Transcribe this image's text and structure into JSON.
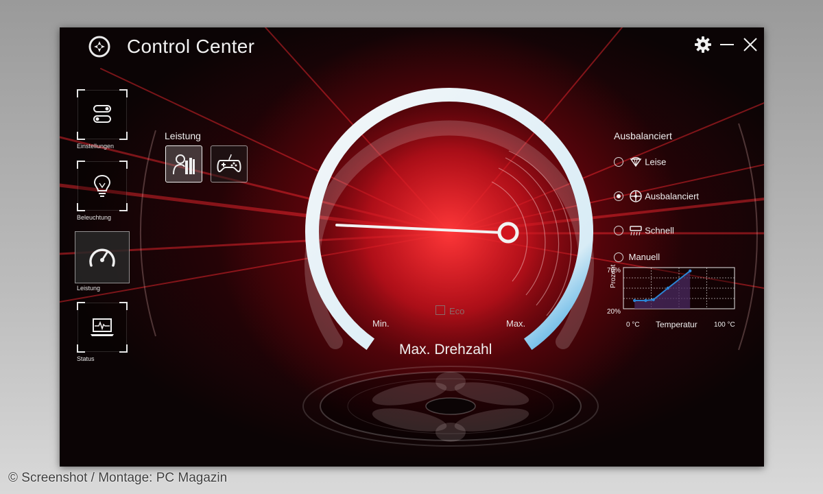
{
  "app": {
    "title": "Control Center"
  },
  "sidebar": {
    "items": [
      {
        "label": "Einstellungen",
        "icon": "toggles-icon",
        "active": false
      },
      {
        "label": "Beleuchtung",
        "icon": "lightbulb-icon",
        "active": false
      },
      {
        "label": "Leistung",
        "icon": "speedometer-icon",
        "active": true
      },
      {
        "label": "Status",
        "icon": "laptop-pulse-icon",
        "active": false
      }
    ]
  },
  "performance": {
    "label": "Leistung",
    "modes": [
      {
        "icon": "office-reader-icon",
        "active": true
      },
      {
        "icon": "gamepad-icon",
        "active": false
      }
    ]
  },
  "gauge": {
    "min_label": "Min.",
    "max_label": "Max.",
    "eco_label": "Eco",
    "eco_checked": false,
    "fan_speed_fraction": 1.0,
    "mode_title": "Max. Drehzahl"
  },
  "fan_profile": {
    "heading": "Ausbalanciert",
    "options": [
      {
        "label": "Leise",
        "icon": "fan-quiet-icon",
        "selected": false
      },
      {
        "label": "Ausbalanciert",
        "icon": "fan-balanced-icon",
        "selected": true
      },
      {
        "label": "Schnell",
        "icon": "fan-fast-icon",
        "selected": false
      },
      {
        "label": "Manuell",
        "icon": "",
        "selected": false
      }
    ]
  },
  "chart_data": {
    "type": "line",
    "xlabel": "Temperatur",
    "ylabel": "Prozent",
    "x_tick_labels": [
      "0 °C",
      "100 °C"
    ],
    "y_tick_labels": [
      "70%",
      "20%"
    ],
    "xlim": [
      0,
      100
    ],
    "ylim": [
      20,
      70
    ],
    "grid": true,
    "series": [
      {
        "x": [
          10,
          20,
          27,
          40,
          60
        ],
        "y": [
          30,
          30,
          31,
          45,
          66
        ]
      }
    ]
  },
  "colors": {
    "accent_red": "#d4141e",
    "gauge_arc": "#dfeef6",
    "gauge_tip": "#2f9fe0",
    "chart_line": "#2b86d6",
    "chart_fill": "#4a2a62"
  },
  "credit": "© Screenshot / Montage: PC Magazin"
}
